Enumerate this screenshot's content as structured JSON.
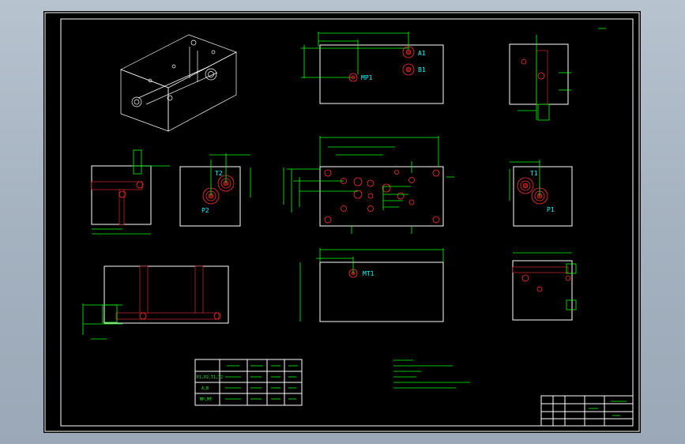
{
  "ports": {
    "a1": "A1",
    "b1": "B1",
    "mp1_top": "MP1",
    "t2": "T2",
    "p2": "P2",
    "t1": "T1",
    "p1": "P1",
    "mt1": "MT1"
  },
  "table": {
    "headers": [
      "",
      "",
      "",
      "",
      ""
    ],
    "rows": [
      [
        "P1,P2,T1,T2",
        "",
        "",
        "",
        ""
      ],
      [
        "A,B",
        "",
        "",
        "",
        ""
      ],
      [
        "MP,MT",
        "",
        "",
        "",
        ""
      ]
    ]
  },
  "notes": [
    "",
    "",
    "",
    "",
    "",
    ""
  ],
  "title_block": {
    "name": ""
  },
  "colors": {
    "background": "#000000",
    "outline": "#ffffff",
    "dimension": "#00ff00",
    "hatch": "#ff3030",
    "label": "#00ffff"
  }
}
